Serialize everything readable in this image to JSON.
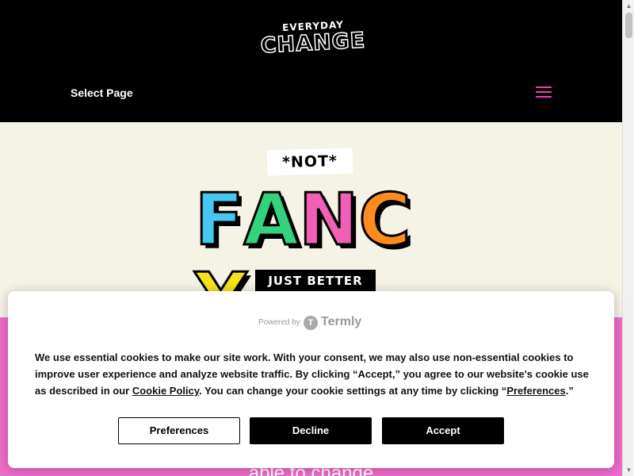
{
  "header": {
    "logo_top": "EVERYDAY",
    "logo_main": "CHANGE",
    "nav_label": "Select Page"
  },
  "hero": {
    "tag": "*NOT*",
    "headline_letters": [
      {
        "char": "F",
        "color": "#46c7f0"
      },
      {
        "char": "A",
        "color": "#34d27c"
      },
      {
        "char": "N",
        "color": "#f15fb6"
      },
      {
        "char": "C",
        "color": "#ff8a1f"
      },
      {
        "char": "Y",
        "color": "#f4e21a"
      }
    ],
    "banner": "JUST BETTER"
  },
  "pink_section": {
    "partial_text": "able to change"
  },
  "cookie_banner": {
    "powered_by": "Powered by",
    "brand": "Termly",
    "text_part1": "We use essential cookies to make our site work. With your consent, we may also use non-essential cookies to improve user experience and analyze website traffic. By clicking “Accept,” you agree to our website's cookie use as described in our ",
    "cookie_policy_link": "Cookie Policy",
    "text_part2": ". You can change your cookie settings at any time by clicking “",
    "preferences_link": "Preferences",
    "text_part3": ".”",
    "buttons": {
      "preferences": "Preferences",
      "decline": "Decline",
      "accept": "Accept"
    }
  },
  "colors": {
    "header_bg": "#000000",
    "hero_bg": "#f5f2e6",
    "pink": "#ef6cc8",
    "hamburger": "#e544a8"
  }
}
